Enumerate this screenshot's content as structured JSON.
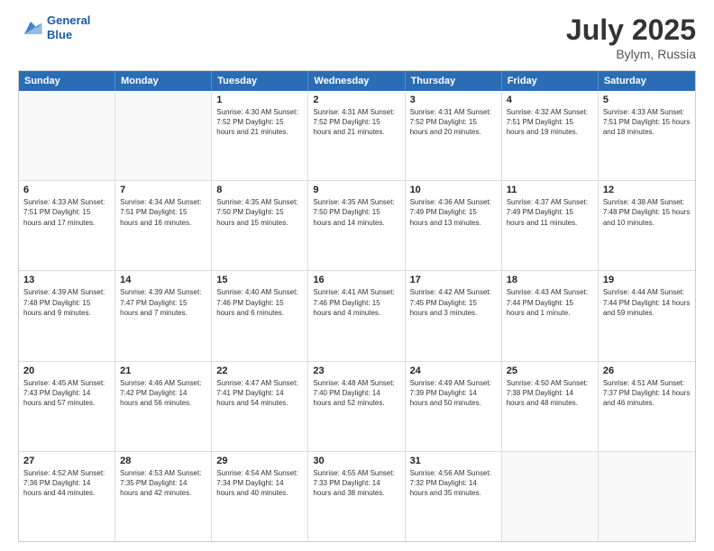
{
  "header": {
    "logo_line1": "General",
    "logo_line2": "Blue",
    "title": "July 2025",
    "location": "Bylym, Russia"
  },
  "weekdays": [
    "Sunday",
    "Monday",
    "Tuesday",
    "Wednesday",
    "Thursday",
    "Friday",
    "Saturday"
  ],
  "rows": [
    [
      {
        "day": "",
        "info": ""
      },
      {
        "day": "",
        "info": ""
      },
      {
        "day": "1",
        "info": "Sunrise: 4:30 AM\nSunset: 7:52 PM\nDaylight: 15 hours\nand 21 minutes."
      },
      {
        "day": "2",
        "info": "Sunrise: 4:31 AM\nSunset: 7:52 PM\nDaylight: 15 hours\nand 21 minutes."
      },
      {
        "day": "3",
        "info": "Sunrise: 4:31 AM\nSunset: 7:52 PM\nDaylight: 15 hours\nand 20 minutes."
      },
      {
        "day": "4",
        "info": "Sunrise: 4:32 AM\nSunset: 7:51 PM\nDaylight: 15 hours\nand 19 minutes."
      },
      {
        "day": "5",
        "info": "Sunrise: 4:33 AM\nSunset: 7:51 PM\nDaylight: 15 hours\nand 18 minutes."
      }
    ],
    [
      {
        "day": "6",
        "info": "Sunrise: 4:33 AM\nSunset: 7:51 PM\nDaylight: 15 hours\nand 17 minutes."
      },
      {
        "day": "7",
        "info": "Sunrise: 4:34 AM\nSunset: 7:51 PM\nDaylight: 15 hours\nand 16 minutes."
      },
      {
        "day": "8",
        "info": "Sunrise: 4:35 AM\nSunset: 7:50 PM\nDaylight: 15 hours\nand 15 minutes."
      },
      {
        "day": "9",
        "info": "Sunrise: 4:35 AM\nSunset: 7:50 PM\nDaylight: 15 hours\nand 14 minutes."
      },
      {
        "day": "10",
        "info": "Sunrise: 4:36 AM\nSunset: 7:49 PM\nDaylight: 15 hours\nand 13 minutes."
      },
      {
        "day": "11",
        "info": "Sunrise: 4:37 AM\nSunset: 7:49 PM\nDaylight: 15 hours\nand 11 minutes."
      },
      {
        "day": "12",
        "info": "Sunrise: 4:38 AM\nSunset: 7:48 PM\nDaylight: 15 hours\nand 10 minutes."
      }
    ],
    [
      {
        "day": "13",
        "info": "Sunrise: 4:39 AM\nSunset: 7:48 PM\nDaylight: 15 hours\nand 9 minutes."
      },
      {
        "day": "14",
        "info": "Sunrise: 4:39 AM\nSunset: 7:47 PM\nDaylight: 15 hours\nand 7 minutes."
      },
      {
        "day": "15",
        "info": "Sunrise: 4:40 AM\nSunset: 7:46 PM\nDaylight: 15 hours\nand 6 minutes."
      },
      {
        "day": "16",
        "info": "Sunrise: 4:41 AM\nSunset: 7:46 PM\nDaylight: 15 hours\nand 4 minutes."
      },
      {
        "day": "17",
        "info": "Sunrise: 4:42 AM\nSunset: 7:45 PM\nDaylight: 15 hours\nand 3 minutes."
      },
      {
        "day": "18",
        "info": "Sunrise: 4:43 AM\nSunset: 7:44 PM\nDaylight: 15 hours\nand 1 minute."
      },
      {
        "day": "19",
        "info": "Sunrise: 4:44 AM\nSunset: 7:44 PM\nDaylight: 14 hours\nand 59 minutes."
      }
    ],
    [
      {
        "day": "20",
        "info": "Sunrise: 4:45 AM\nSunset: 7:43 PM\nDaylight: 14 hours\nand 57 minutes."
      },
      {
        "day": "21",
        "info": "Sunrise: 4:46 AM\nSunset: 7:42 PM\nDaylight: 14 hours\nand 56 minutes."
      },
      {
        "day": "22",
        "info": "Sunrise: 4:47 AM\nSunset: 7:41 PM\nDaylight: 14 hours\nand 54 minutes."
      },
      {
        "day": "23",
        "info": "Sunrise: 4:48 AM\nSunset: 7:40 PM\nDaylight: 14 hours\nand 52 minutes."
      },
      {
        "day": "24",
        "info": "Sunrise: 4:49 AM\nSunset: 7:39 PM\nDaylight: 14 hours\nand 50 minutes."
      },
      {
        "day": "25",
        "info": "Sunrise: 4:50 AM\nSunset: 7:38 PM\nDaylight: 14 hours\nand 48 minutes."
      },
      {
        "day": "26",
        "info": "Sunrise: 4:51 AM\nSunset: 7:37 PM\nDaylight: 14 hours\nand 46 minutes."
      }
    ],
    [
      {
        "day": "27",
        "info": "Sunrise: 4:52 AM\nSunset: 7:36 PM\nDaylight: 14 hours\nand 44 minutes."
      },
      {
        "day": "28",
        "info": "Sunrise: 4:53 AM\nSunset: 7:35 PM\nDaylight: 14 hours\nand 42 minutes."
      },
      {
        "day": "29",
        "info": "Sunrise: 4:54 AM\nSunset: 7:34 PM\nDaylight: 14 hours\nand 40 minutes."
      },
      {
        "day": "30",
        "info": "Sunrise: 4:55 AM\nSunset: 7:33 PM\nDaylight: 14 hours\nand 38 minutes."
      },
      {
        "day": "31",
        "info": "Sunrise: 4:56 AM\nSunset: 7:32 PM\nDaylight: 14 hours\nand 35 minutes."
      },
      {
        "day": "",
        "info": ""
      },
      {
        "day": "",
        "info": ""
      }
    ]
  ]
}
